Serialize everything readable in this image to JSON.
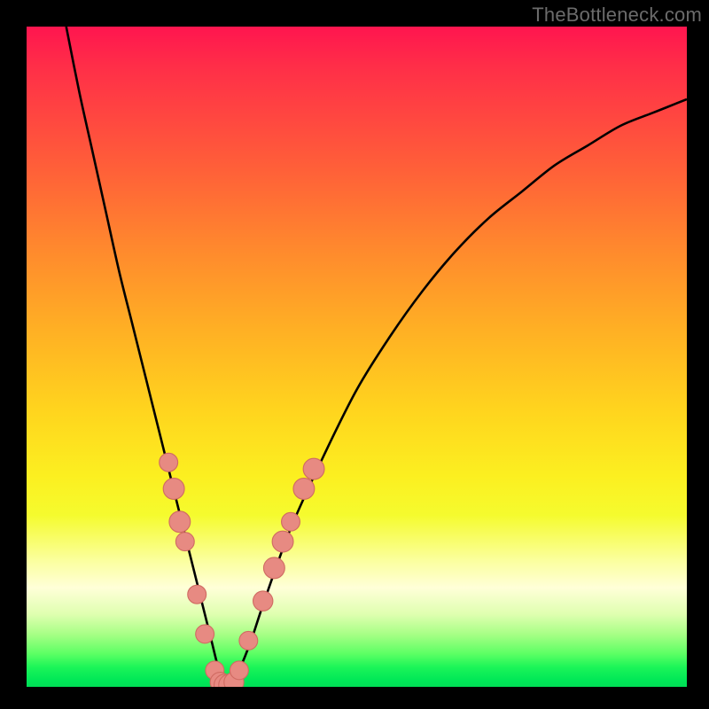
{
  "watermark": "TheBottleneck.com",
  "colors": {
    "curve": "#000000",
    "marker_fill": "#e78a82",
    "marker_stroke": "#d06b62",
    "frame": "#000000"
  },
  "chart_data": {
    "type": "line",
    "title": "",
    "xlabel": "",
    "ylabel": "",
    "xlim": [
      0,
      100
    ],
    "ylim": [
      0,
      100
    ],
    "grid": false,
    "series": [
      {
        "name": "bottleneck-curve",
        "x": [
          6,
          8,
          10,
          12,
          14,
          16,
          18,
          20,
          22,
          24,
          25,
          26,
          27,
          28,
          29,
          30,
          31,
          32,
          34,
          36,
          40,
          45,
          50,
          55,
          60,
          65,
          70,
          75,
          80,
          85,
          90,
          95,
          100
        ],
        "y": [
          100,
          90,
          81,
          72,
          63,
          55,
          47,
          39,
          31,
          23,
          19,
          15,
          11,
          7,
          3,
          0,
          0,
          2,
          7,
          13,
          24,
          35,
          45,
          53,
          60,
          66,
          71,
          75,
          79,
          82,
          85,
          87,
          89
        ]
      }
    ],
    "markers": [
      {
        "x": 21.5,
        "y": 34,
        "r": 1.4
      },
      {
        "x": 22.3,
        "y": 30,
        "r": 1.6
      },
      {
        "x": 23.2,
        "y": 25,
        "r": 1.6
      },
      {
        "x": 24.0,
        "y": 22,
        "r": 1.4
      },
      {
        "x": 25.8,
        "y": 14,
        "r": 1.4
      },
      {
        "x": 27.0,
        "y": 8,
        "r": 1.4
      },
      {
        "x": 28.5,
        "y": 2.5,
        "r": 1.4
      },
      {
        "x": 29.3,
        "y": 0.7,
        "r": 1.5
      },
      {
        "x": 30.0,
        "y": 0.3,
        "r": 1.6
      },
      {
        "x": 30.7,
        "y": 0.3,
        "r": 1.6
      },
      {
        "x": 31.4,
        "y": 0.7,
        "r": 1.5
      },
      {
        "x": 32.2,
        "y": 2.5,
        "r": 1.4
      },
      {
        "x": 33.6,
        "y": 7,
        "r": 1.4
      },
      {
        "x": 35.8,
        "y": 13,
        "r": 1.5
      },
      {
        "x": 37.5,
        "y": 18,
        "r": 1.6
      },
      {
        "x": 38.8,
        "y": 22,
        "r": 1.6
      },
      {
        "x": 40.0,
        "y": 25,
        "r": 1.4
      },
      {
        "x": 42.0,
        "y": 30,
        "r": 1.6
      },
      {
        "x": 43.5,
        "y": 33,
        "r": 1.6
      }
    ]
  }
}
